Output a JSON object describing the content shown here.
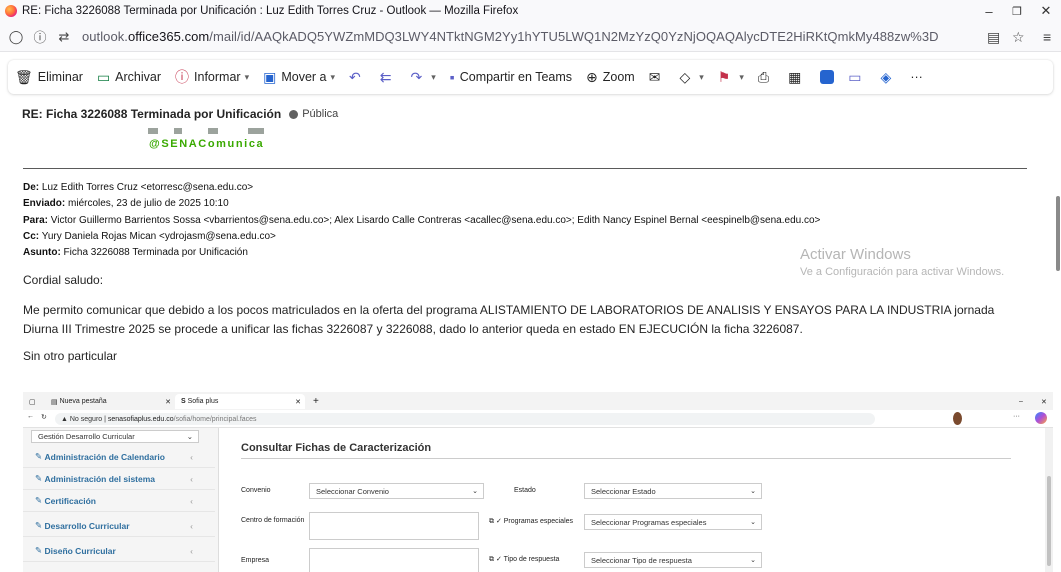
{
  "window": {
    "title": "RE: Ficha 3226088 Terminada por Unificación : Luz Edith Torres Cruz - Outlook — Mozilla Firefox",
    "controls": [
      "–",
      "❐",
      "✕"
    ]
  },
  "browser": {
    "url_prefix": "outlook.",
    "url_domain": "office365.com",
    "url_path": "/mail/id/AAQkADQ5YWZmMDQ3LWY4NTktNGM2Yy1hYTU5LWQ1N2MzYzQ0YzNjOQAQAlycDTE2HiRKtQmkMy488zw%3D"
  },
  "ribbon": {
    "delete": "Eliminar",
    "archive": "Archivar",
    "report": "Informar",
    "move": "Mover a",
    "share_teams": "Compartir en Teams",
    "zoom": "Zoom",
    "more": "···"
  },
  "message": {
    "subject": "RE: Ficha 3226088 Terminada por Unificación",
    "visibility": "Pública",
    "signature_tag": "@SENAComunica",
    "from_label": "De:",
    "from": " Luz Edith Torres Cruz <etorresc@sena.edu.co>",
    "sent_label": "Enviado:",
    "sent": " miércoles, 23 de julio de 2025 10:10",
    "to_label": "Para:",
    "to": " Victor Guillermo Barrientos Sossa <vbarrientos@sena.edu.co>; Alex Lisardo Calle Contreras <acallec@sena.edu.co>; Edith Nancy Espinel Bernal <eespinelb@sena.edu.co>",
    "cc_label": "Cc:",
    "cc": " Yury Daniela Rojas Mican <ydrojasm@sena.edu.co>",
    "subject_label": "Asunto:",
    "subject_value": " Ficha 3226088 Terminada por Unificación",
    "greeting": "Cordial saludo:",
    "paragraph": "Me permito comunicar que debido a los pocos matriculados  en la oferta del programa ALISTAMIENTO DE LABORATORIOS DE ANALISIS Y ENSAYOS PARA LA INDUSTRIA jornada Diurna III Trimestre 2025 se procede a unificar las fichas 3226087 y 3226088, dado lo anterior queda en estado EN EJECUCIÓN la ficha 3226087.",
    "closing": "Sin otro particular"
  },
  "embedded": {
    "tab1": "Nueva pestaña",
    "tab2": "Sofia plus",
    "not_secure": "No seguro",
    "url_host": "senasofiaplus.edu.co",
    "url_path": "/sofia/home/principal.faces",
    "sidebar_select": "Gestión Desarrollo Curricular",
    "sidebar_items": [
      "Administración de Calendario",
      "Administración del sistema",
      "Certificación",
      "Desarrollo Curricular",
      "Diseño Curricular"
    ],
    "page_title": "Consultar Fichas de Caracterización",
    "labels": {
      "convenio": "Convenio",
      "estado": "Estado",
      "centro": "Centro de formación",
      "programas": "Programas especiales",
      "empresa": "Empresa",
      "tipo_respuesta": "Tipo de respuesta"
    },
    "selects": {
      "convenio": "Seleccionar Convenio",
      "estado": "Seleccionar Estado",
      "programas": "Seleccionar Programas especiales",
      "tipo_respuesta": "Seleccionar Tipo de respuesta"
    },
    "watermark_title": "Activar Windows",
    "watermark_sub": "Ve a Configuración para activar Windows."
  }
}
